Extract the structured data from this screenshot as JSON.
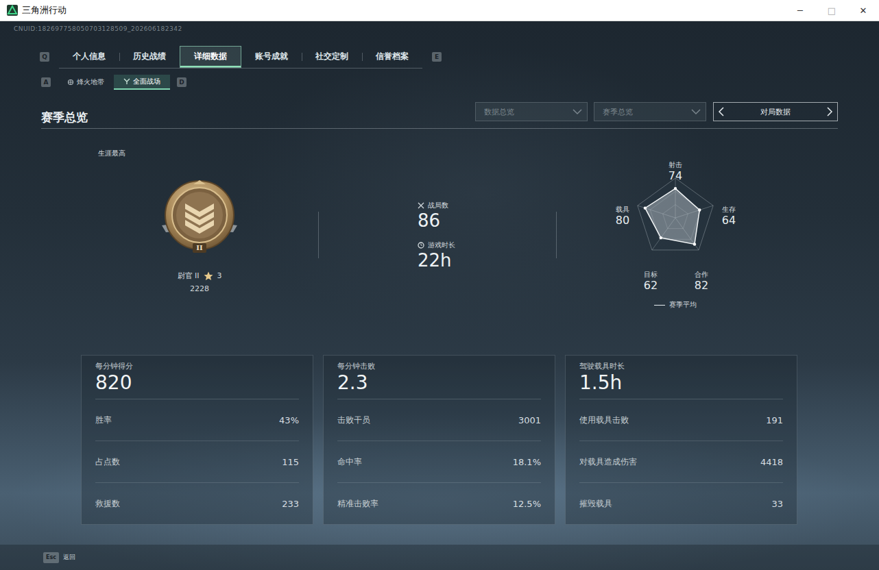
{
  "window": {
    "title": "三角洲行动",
    "controls": [
      "─",
      "□",
      "✕"
    ]
  },
  "uid": "CNUID:182697758050703128509_202606182342",
  "tabs": {
    "prev_key": "Q",
    "next_key": "E",
    "items": [
      {
        "label": "个人信息",
        "selected": false
      },
      {
        "label": "历史战绩",
        "selected": false
      },
      {
        "label": "详细数据",
        "selected": true
      },
      {
        "label": "账号成就",
        "selected": false
      },
      {
        "label": "社交定制",
        "selected": false
      },
      {
        "label": "信誉档案",
        "selected": false
      }
    ]
  },
  "subtabs": {
    "prev_key": "A",
    "next_key": "D",
    "items": [
      {
        "label": "烽火地带",
        "selected": false
      },
      {
        "label": "全面战场",
        "selected": true
      }
    ]
  },
  "section": {
    "title": "赛季总览",
    "filters": [
      {
        "label": "数据总览"
      },
      {
        "label": "赛季总览"
      }
    ],
    "switcher": {
      "label": "对局数据"
    }
  },
  "career": {
    "title": "生涯最高",
    "badge_numeral": "II",
    "rank": "尉官 II",
    "stars": "3",
    "score": "2228"
  },
  "summary": [
    {
      "kind": "matches",
      "label": "战局数",
      "value": "86"
    },
    {
      "kind": "time",
      "label": "游戏时长",
      "value": "22h"
    }
  ],
  "radar": {
    "axes": [
      {
        "label": "射击",
        "reading": "74",
        "value": 74
      },
      {
        "label": "生存",
        "reading": "64",
        "value": 64
      },
      {
        "label": "合作",
        "reading": "82",
        "value": 82
      },
      {
        "label": "目标",
        "reading": "62",
        "value": 62
      },
      {
        "label": "载具",
        "reading": "80",
        "value": 80
      }
    ],
    "legend": "赛季平均"
  },
  "cards": [
    {
      "title": "每分钟得分",
      "value": "820",
      "rows": [
        {
          "label": "胜率",
          "value": "43%"
        },
        {
          "label": "占点数",
          "value": "115"
        },
        {
          "label": "救援数",
          "value": "233"
        }
      ]
    },
    {
      "title": "每分钟击败",
      "value": "2.3",
      "rows": [
        {
          "label": "击败干员",
          "value": "3001"
        },
        {
          "label": "命中率",
          "value": "18.1%"
        },
        {
          "label": "精准击败率",
          "value": "12.5%"
        }
      ]
    },
    {
      "title": "驾驶载具时长",
      "value": "1.5h",
      "rows": [
        {
          "label": "使用载具击败",
          "value": "191"
        },
        {
          "label": "对载具造成伤害",
          "value": "4418"
        },
        {
          "label": "摧毁载具",
          "value": "33"
        }
      ]
    }
  ],
  "footer": {
    "key": "Esc",
    "label": "返回"
  }
}
